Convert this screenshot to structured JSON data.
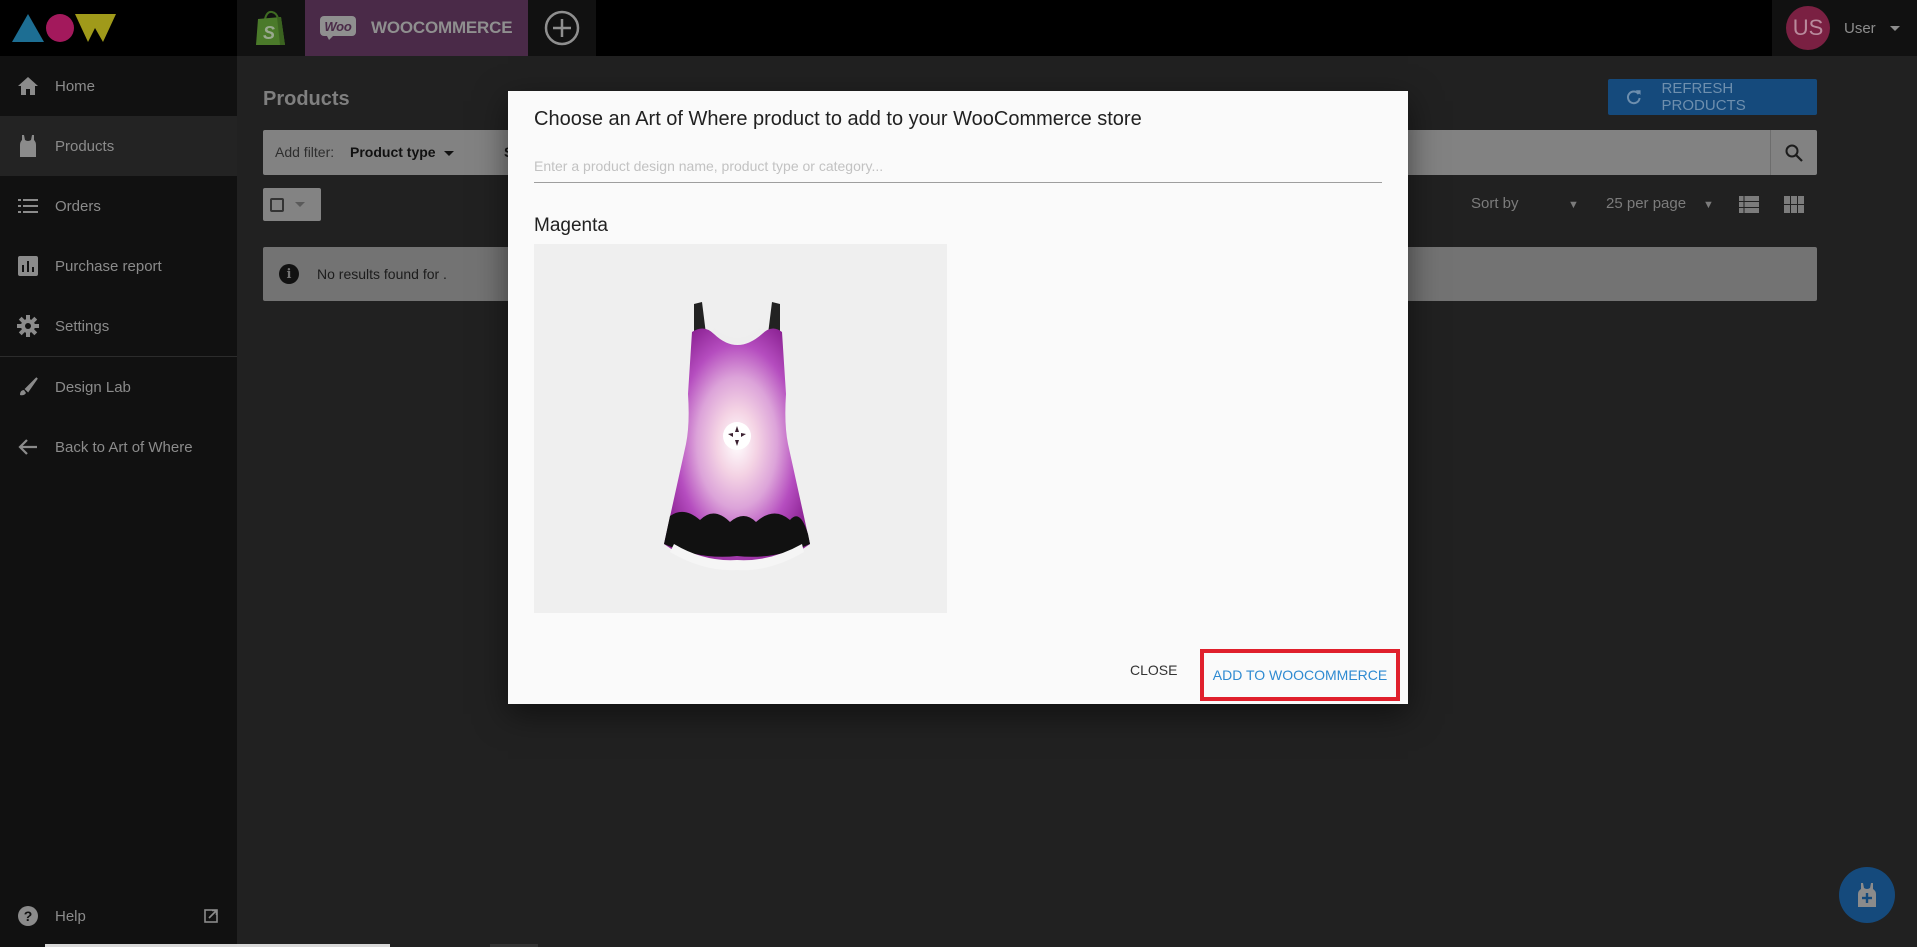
{
  "topbar": {
    "logo_name": "Art of Where",
    "stores": [
      {
        "id": "shopify",
        "icon": "shopify-bag-icon"
      },
      {
        "id": "woocommerce",
        "icon": "woo-badge-icon",
        "label": "WOOCOMMERCE",
        "badge": "Woo",
        "active": true
      },
      {
        "id": "add",
        "icon": "add-circle-icon"
      }
    ],
    "user": {
      "initials": "US",
      "name": "User"
    }
  },
  "sidebar": {
    "items": [
      {
        "label": "Home",
        "icon": "home-icon"
      },
      {
        "label": "Products",
        "icon": "tank-top-icon",
        "active": true
      },
      {
        "label": "Orders",
        "icon": "list-icon"
      },
      {
        "label": "Purchase report",
        "icon": "bar-chart-icon"
      },
      {
        "label": "Settings",
        "icon": "gear-icon"
      },
      {
        "label": "Design Lab",
        "icon": "brush-icon"
      },
      {
        "label": "Back to Art of Where",
        "icon": "arrow-left-icon"
      }
    ],
    "help": {
      "label": "Help",
      "icon": "help-icon",
      "external_icon": "external-link-icon"
    }
  },
  "main": {
    "title": "Products",
    "refresh_label": "REFRESH PRODUCTS",
    "filter": {
      "label": "Add filter:",
      "product_type": "Product type",
      "sync": "Sync"
    },
    "sort_by": "Sort by",
    "per_page": "25 per page",
    "no_results": "No results found for ."
  },
  "modal": {
    "title": "Choose an Art of Where product to add to your WooCommerce store",
    "search_placeholder": "Enter a product design name, product type or category...",
    "search_value": "",
    "product": {
      "name": "Magenta",
      "type": "flare dress"
    },
    "close_label": "CLOSE",
    "add_label": "ADD TO WOOCOMMERCE"
  },
  "colors": {
    "accent_blue": "#154a7c",
    "woo_purple": "#4a2a48",
    "link_blue": "#2e8ad1",
    "highlight_red": "#e0202c",
    "avatar": "#7a2042"
  }
}
